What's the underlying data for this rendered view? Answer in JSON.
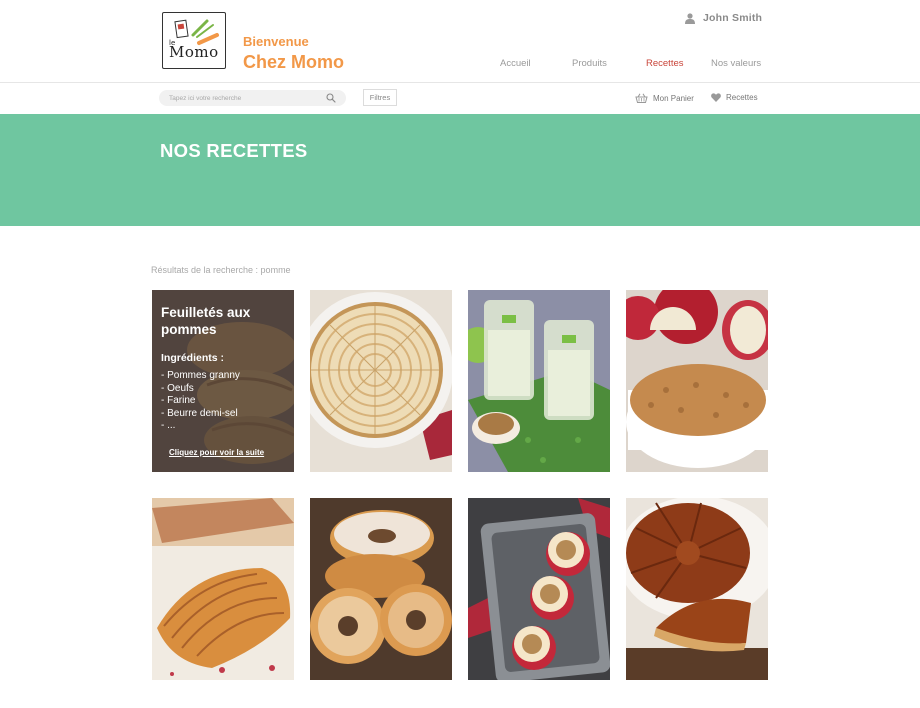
{
  "header": {
    "welcome_line1": "Bienvenue",
    "welcome_line2": "Chez Momo",
    "logo_text": "Momo",
    "logo_small": "le",
    "user_name": "John Smith",
    "nav": [
      {
        "label": "Accueil",
        "active": false
      },
      {
        "label": "Produits",
        "active": false
      },
      {
        "label": "Recettes",
        "active": true
      },
      {
        "label": "Nos valeurs",
        "active": false
      }
    ]
  },
  "toolbar": {
    "search_placeholder": "Tapez ici votre recherche",
    "filters_label": "Filtres",
    "cart_label": "Mon Panier",
    "favorites_label": "Recettes"
  },
  "banner": {
    "title": "NOS RECETTES"
  },
  "results": {
    "label": "Résultats de la recherche : pomme"
  },
  "featured": {
    "title": "Feuilletés aux pommes",
    "ingredients_label": "Ingrédients :",
    "ingredients": [
      "- Pommes granny",
      "- Oeufs",
      "- Farine",
      "- Beurre demi-sel",
      "- ..."
    ],
    "link": "Cliquez pour voir la suite"
  },
  "recipes": [
    {
      "icon": "apple-puff-pastry-photo"
    },
    {
      "icon": "apple-tart-photo"
    },
    {
      "icon": "apple-smoothie-photo"
    },
    {
      "icon": "apple-crumble-photo"
    },
    {
      "icon": "apple-turnover-photo"
    },
    {
      "icon": "apple-donuts-photo"
    },
    {
      "icon": "baked-apples-photo"
    },
    {
      "icon": "tarte-tatin-photo"
    }
  ],
  "colors": {
    "accent_orange": "#f29848",
    "banner_green": "#6fc6a0",
    "active_nav": "#c9453a"
  }
}
